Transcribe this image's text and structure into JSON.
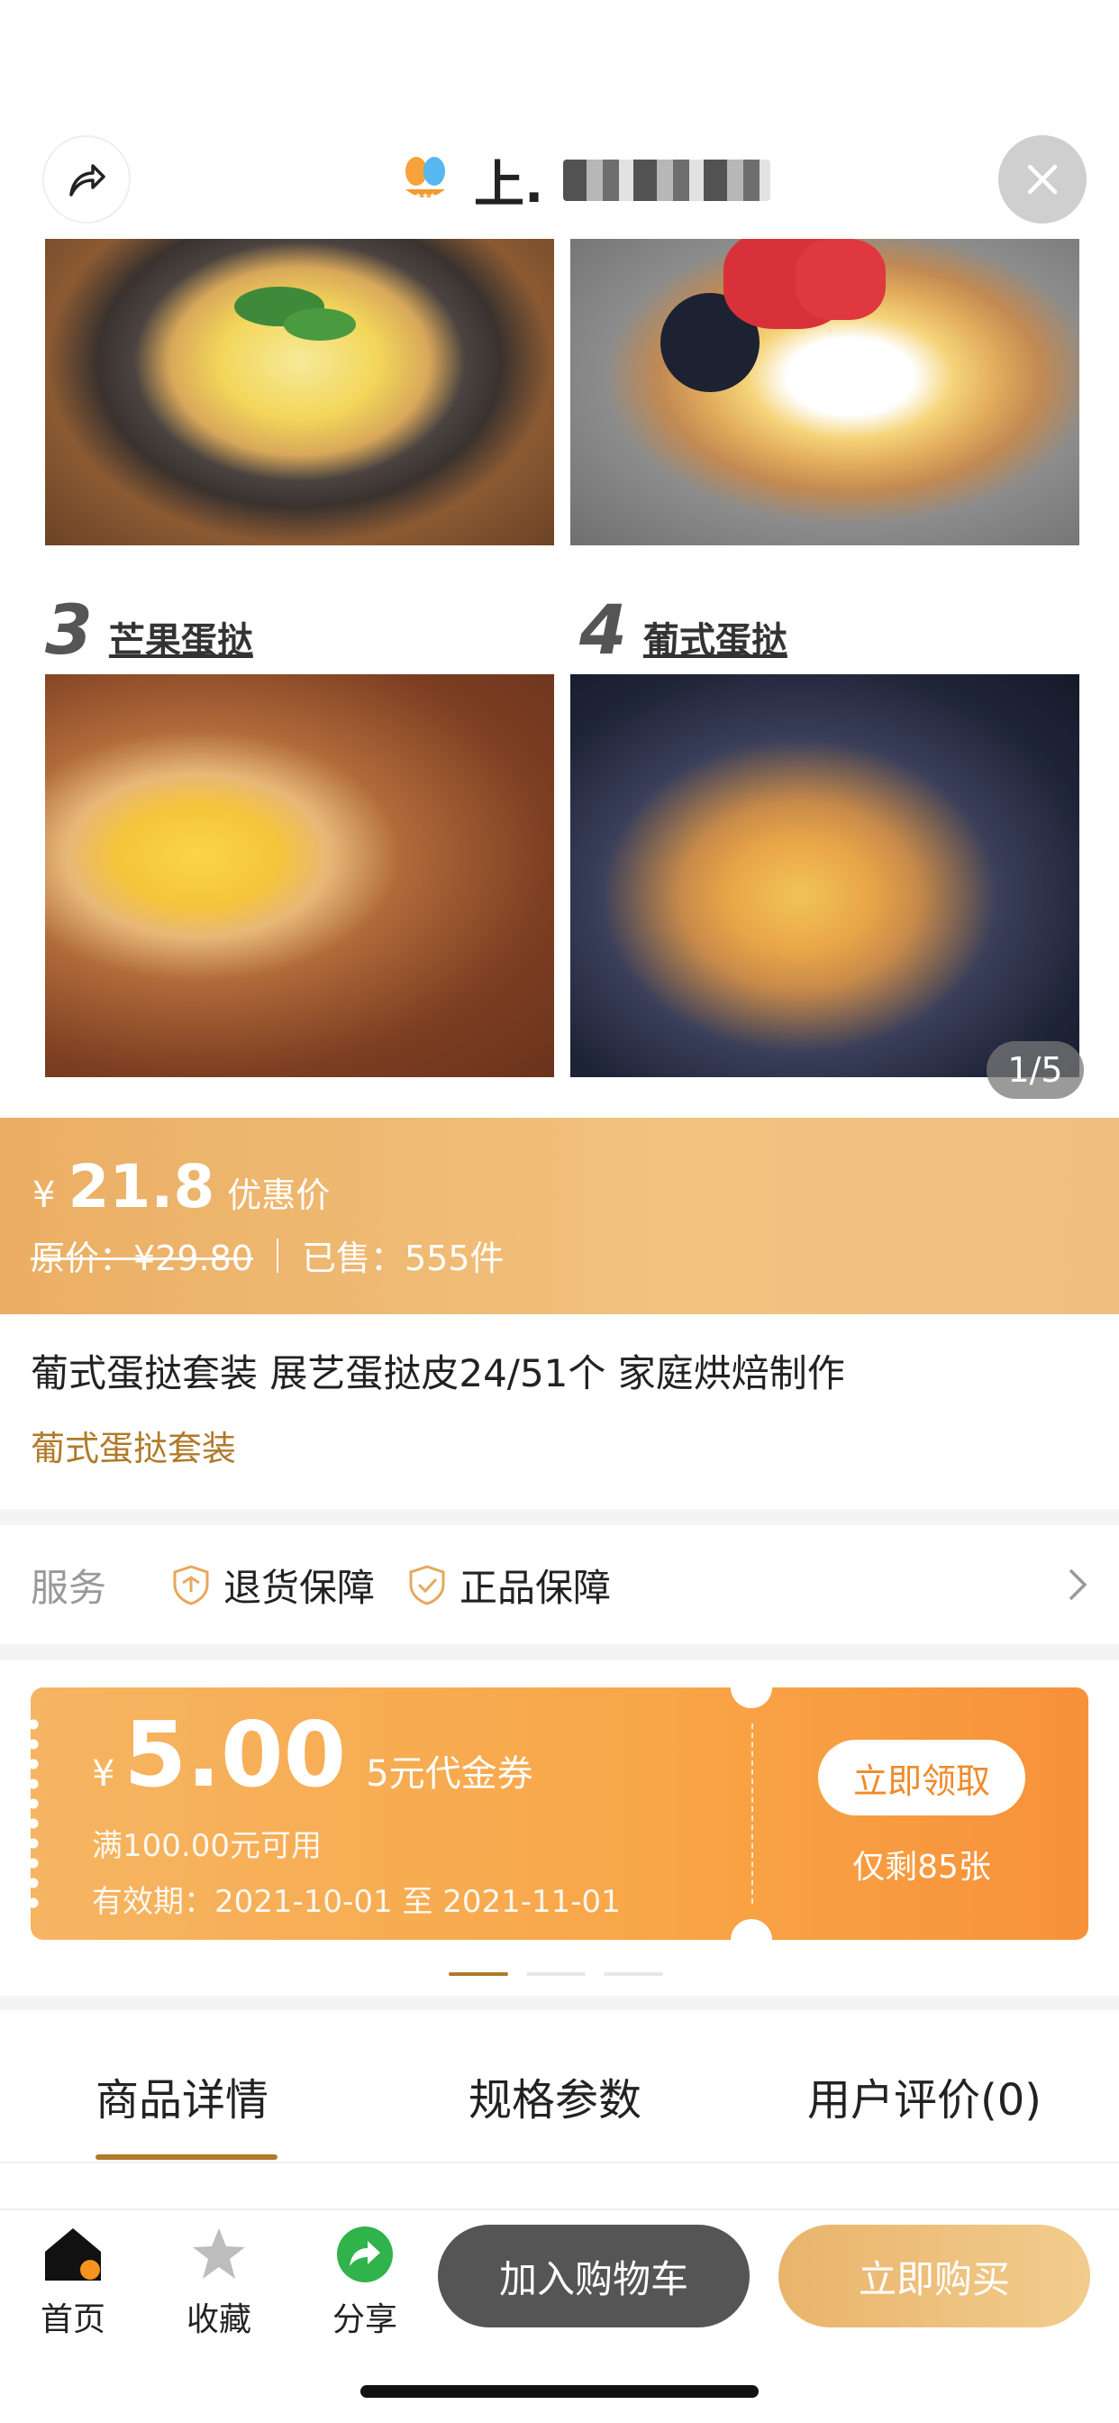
{
  "header": {
    "store_name_visible": "上.",
    "share_icon": "share-arrow-icon",
    "close_icon": "close-icon",
    "logo_icon": "butterfly-logo-icon"
  },
  "gallery": {
    "items": [
      {
        "number": "3",
        "label": "芒果蛋挞"
      },
      {
        "number": "4",
        "label": "葡式蛋挞"
      }
    ],
    "pager": "1/5"
  },
  "price": {
    "currency": "¥",
    "current": "21.8",
    "current_tag": "优惠价",
    "original": "原价：¥29.80",
    "sold": "已售：555件"
  },
  "product": {
    "title": "葡式蛋挞套装 展艺蛋挞皮24/51个 家庭烘焙制作",
    "subtitle": "葡式蛋挞套装"
  },
  "service": {
    "label": "服务",
    "items": [
      {
        "label": "退货保障",
        "icon": "return-shield-icon"
      },
      {
        "label": "正品保障",
        "icon": "genuine-shield-icon"
      }
    ]
  },
  "coupon": {
    "currency": "¥",
    "amount": "5.00",
    "name": "5元代金券",
    "condition": "满100.00元可用",
    "validity": "有效期：2021-10-01 至 2021-11-01",
    "claim_label": "立即领取",
    "remaining": "仅剩85张",
    "page_count": 3,
    "active_page": 0
  },
  "tabs": [
    {
      "label": "商品详情",
      "active": true
    },
    {
      "label": "规格参数",
      "active": false
    },
    {
      "label": "用户评价(0)",
      "active": false
    }
  ],
  "bottom_bar": {
    "nav": [
      {
        "label": "首页",
        "icon": "home-icon"
      },
      {
        "label": "收藏",
        "icon": "star-icon"
      },
      {
        "label": "分享",
        "icon": "share-icon"
      }
    ],
    "add_to_cart": "加入购物车",
    "buy_now": "立即购买"
  },
  "colors": {
    "accent": "#b07a2a",
    "price_band": "#ebae63",
    "coupon": "#f8a647",
    "cart_button": "#555555"
  }
}
